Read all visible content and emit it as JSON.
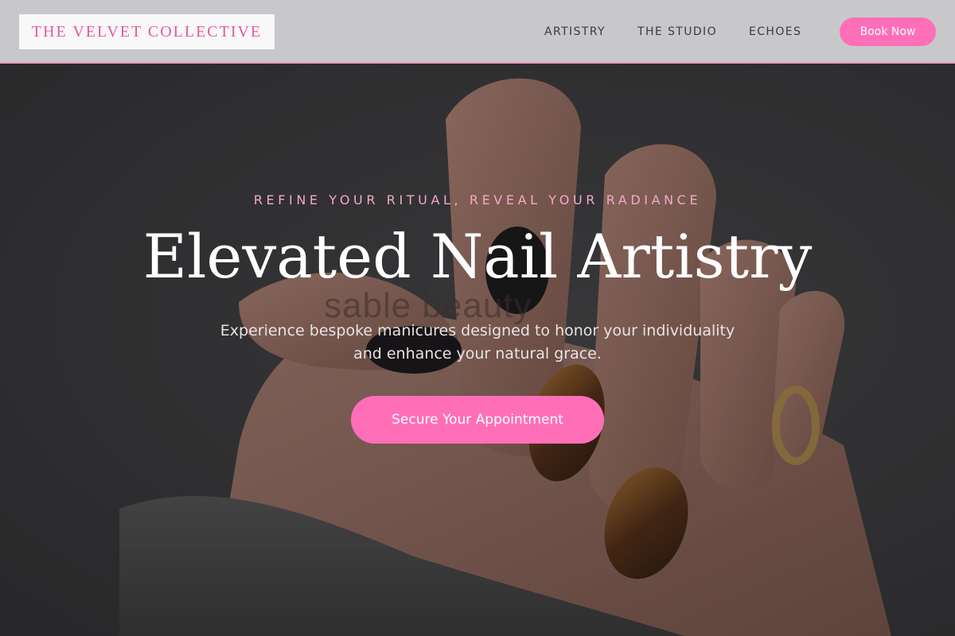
{
  "brand": {
    "name": "THE VELVET COLLECTIVE"
  },
  "nav": {
    "items": [
      {
        "label": "ARTISTRY"
      },
      {
        "label": "THE STUDIO"
      },
      {
        "label": "ECHOES"
      }
    ],
    "book_label": "Book Now"
  },
  "hero": {
    "tagline": "REFINE YOUR RITUAL, REVEAL YOUR RADIANCE",
    "headline": "Elevated Nail Artistry",
    "subtext_line1": "Experience bespoke manicures designed to honor your individuality",
    "subtext_line2": "and enhance your natural grace.",
    "cta_label": "Secure Your Appointment",
    "image_watermark": "sable beauty"
  },
  "colors": {
    "accent_pink": "#ff6fb8",
    "logo_pink": "#e5589e",
    "tagline_pink": "#f3a9c8",
    "navbar_bg": "#cdcdcf"
  }
}
